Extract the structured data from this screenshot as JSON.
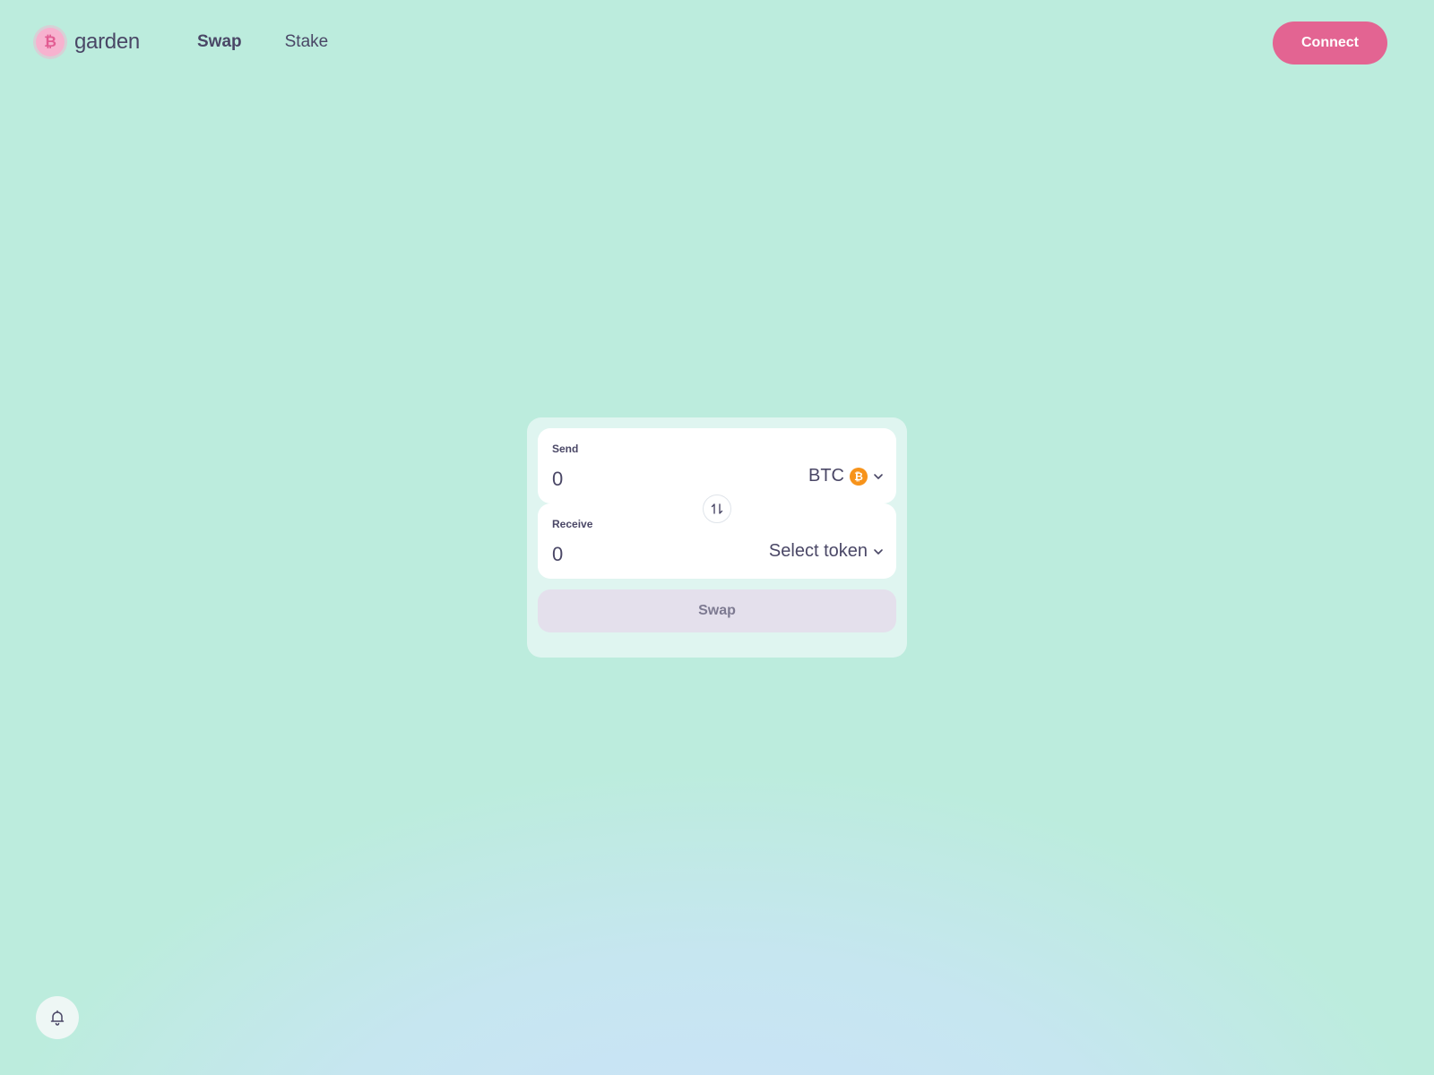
{
  "brand": {
    "name": "garden",
    "logo_glyph": "₿",
    "accent": "#e36492"
  },
  "nav": {
    "items": [
      {
        "label": "Swap",
        "active": true
      },
      {
        "label": "Stake",
        "active": false
      }
    ]
  },
  "header": {
    "connect_label": "Connect"
  },
  "swap": {
    "send": {
      "label": "Send",
      "amount": "0",
      "token": "BTC",
      "token_glyph": "₿",
      "token_color": "#f7931a"
    },
    "receive": {
      "label": "Receive",
      "amount": "0",
      "token": "Select token"
    },
    "swap_label": "Swap"
  },
  "icons": {
    "switch": "swap-vertical-icon",
    "notifications": "bell-icon"
  }
}
